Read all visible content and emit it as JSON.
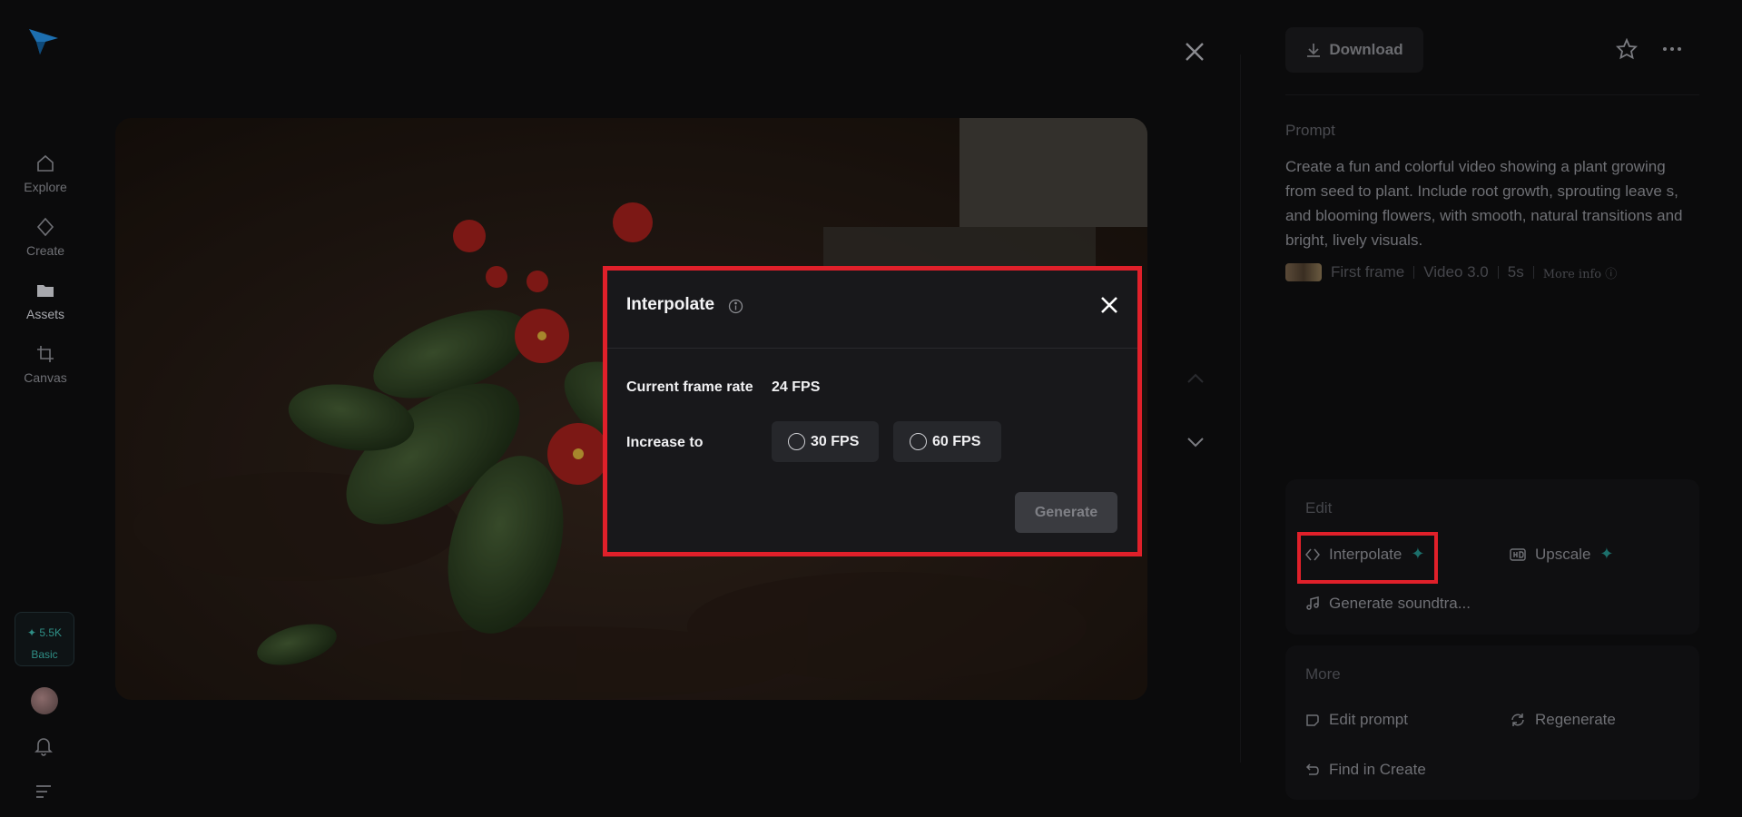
{
  "sidebar": {
    "items": [
      {
        "label": "Explore",
        "icon": "home-icon"
      },
      {
        "label": "Create",
        "icon": "diamond-icon"
      },
      {
        "label": "Assets",
        "icon": "folder-icon"
      },
      {
        "label": "Canvas",
        "icon": "crop-icon"
      }
    ],
    "credits": {
      "amount": "✦ 5.5K",
      "plan": "Basic"
    }
  },
  "right_panel": {
    "download_label": "Download",
    "prompt_label": "Prompt",
    "prompt_text": "Create a fun and colorful video showing a plant growing from seed to plant. Include root growth, sprouting leave s, and blooming flowers, with smooth, natural transitions and bright, lively visuals.",
    "meta": {
      "frame_label": "First frame",
      "model": "Video 3.0",
      "duration": "5s",
      "more_info": "More info"
    },
    "edit": {
      "title": "Edit",
      "interpolate": "Interpolate",
      "upscale": "Upscale",
      "soundtrack": "Generate soundtra..."
    },
    "more": {
      "title": "More",
      "edit_prompt": "Edit prompt",
      "regenerate": "Regenerate",
      "find_in_create": "Find in Create"
    }
  },
  "modal": {
    "title": "Interpolate",
    "current_label": "Current frame rate",
    "current_value": "24 FPS",
    "increase_label": "Increase to",
    "options": [
      "30 FPS",
      "60 FPS"
    ],
    "generate_label": "Generate"
  },
  "colors": {
    "highlight": "#e0202a",
    "accent": "#1c6f6b"
  }
}
